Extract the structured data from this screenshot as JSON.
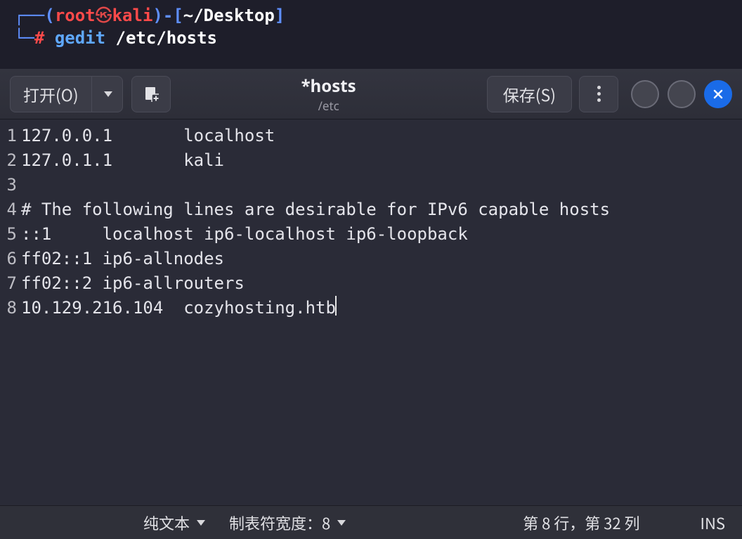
{
  "terminal": {
    "user": "root",
    "host": "kali",
    "path": "~/Desktop",
    "prompt_symbol": "#",
    "command": "gedit",
    "argument": "/etc/hosts"
  },
  "gedit": {
    "header": {
      "open_label": "打开(O)",
      "save_label": "保存(S)",
      "title": "*hosts",
      "subtitle": "/etc"
    },
    "lines": [
      {
        "num": "1",
        "text": "127.0.0.1       localhost"
      },
      {
        "num": "2",
        "text": "127.0.1.1       kali"
      },
      {
        "num": "3",
        "text": ""
      },
      {
        "num": "4",
        "text": "# The following lines are desirable for IPv6 capable hosts"
      },
      {
        "num": "5",
        "text": "::1     localhost ip6-localhost ip6-loopback"
      },
      {
        "num": "6",
        "text": "ff02::1 ip6-allnodes"
      },
      {
        "num": "7",
        "text": "ff02::2 ip6-allrouters"
      },
      {
        "num": "8",
        "text": "10.129.216.104  cozyhosting.htb"
      }
    ],
    "statusbar": {
      "syntax": "纯文本",
      "tabwidth": "制表符宽度：8",
      "position": "第 8 行，第 32 列",
      "mode": "INS"
    }
  }
}
